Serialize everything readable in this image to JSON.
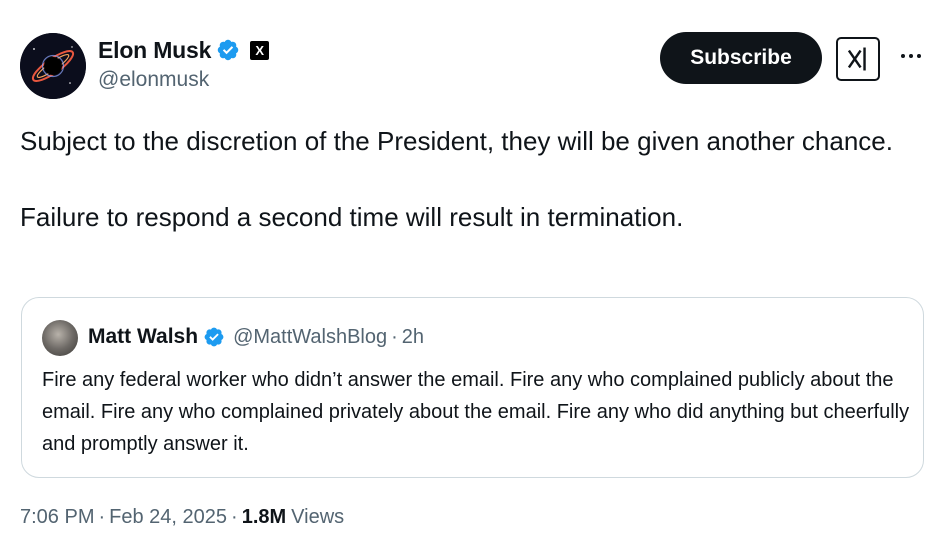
{
  "author": {
    "display_name": "Elon Musk",
    "handle": "@elonmusk",
    "verified_icon": "verified-badge",
    "org_badge": "X"
  },
  "actions": {
    "subscribe_label": "Subscribe",
    "grok_icon": "grok-icon",
    "more_icon": "more-icon"
  },
  "tweet": {
    "paragraphs": [
      "Subject to the discretion of the President, they will be given another chance.",
      "Failure to respond a second time will result in termination."
    ]
  },
  "quoted_tweet": {
    "display_name": "Matt Walsh",
    "handle": "@MattWalshBlog",
    "separator": "·",
    "time": "2h",
    "text": "Fire any federal worker who didn’t answer the email. Fire any who complained publicly about the email. Fire any who complained privately about the email. Fire any who did anything but cheerfully and promptly answer it."
  },
  "meta": {
    "time": "7:06 PM",
    "separator": "·",
    "date": "Feb 24, 2025",
    "separator2": "·",
    "views_count": "1.8M",
    "views_label": "Views"
  },
  "colors": {
    "verified_blue": "#1d9bf0",
    "text": "#0f1419",
    "muted": "#536471",
    "border": "#cfd9de"
  }
}
